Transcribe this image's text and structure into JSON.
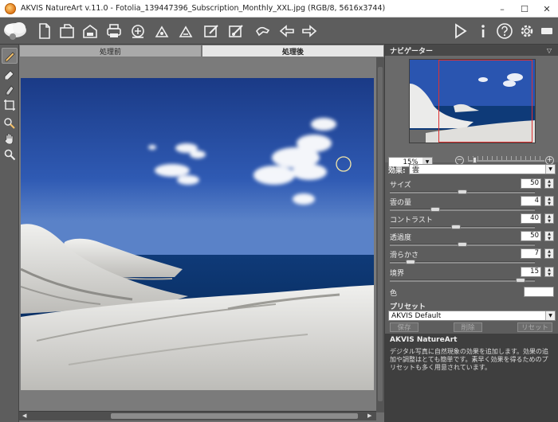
{
  "window": {
    "title": "AKVIS NatureArt v.11.0 - Fotolia_139447396_Subscription_Monthly_XXL.jpg (RGB/8, 5616x3744)",
    "minimize": "–",
    "maximize": "☐",
    "close": "✕"
  },
  "toolbar": {
    "left_icons": [
      "open-file-icon",
      "open-folder-icon",
      "save-icon",
      "print-icon",
      "share-icon",
      "batch-icon",
      "batch-process-icon",
      "background-icon",
      "plugin-icon",
      "settings-hand-icon",
      "undo-icon",
      "redo-icon"
    ],
    "right_icons": [
      "run-icon",
      "info-icon",
      "help-icon",
      "preferences-icon",
      "layout-icon"
    ]
  },
  "tools": [
    "brush-icon",
    "eraser-icon",
    "eraser2-icon",
    "crop-icon",
    "picker-icon",
    "hand-icon",
    "zoom-icon"
  ],
  "tabs": [
    {
      "label": "処理前",
      "active": false
    },
    {
      "label": "処理後",
      "active": true
    }
  ],
  "navigator": {
    "title": "ナビゲーター",
    "zoom": "15%"
  },
  "settings": {
    "effect_label": "効果:",
    "effect_value": "雲",
    "params": [
      {
        "name": "サイズ",
        "value": "50",
        "level": 0.5
      },
      {
        "name": "雲の量",
        "value": "4",
        "level": 0.3
      },
      {
        "name": "コントラスト",
        "value": "40",
        "level": 0.45
      },
      {
        "name": "透過度",
        "value": "50",
        "level": 0.5
      },
      {
        "name": "滑らかさ",
        "value": "7",
        "level": 0.12
      },
      {
        "name": "境界",
        "value": "15",
        "level": 0.93
      }
    ],
    "color_label": "色",
    "color_value": "#ffffff"
  },
  "presets": {
    "title": "プリセット",
    "selected": "AKVIS Default",
    "save": "保存",
    "delete": "削除",
    "reset": "リセット"
  },
  "info": {
    "title": "AKVIS NatureArt",
    "text": "デジタル写真に自然現象の効果を追加します。効果の追加や調整はとても簡単です。素早く効果を得るためのプリセットも多く用意されています。"
  }
}
